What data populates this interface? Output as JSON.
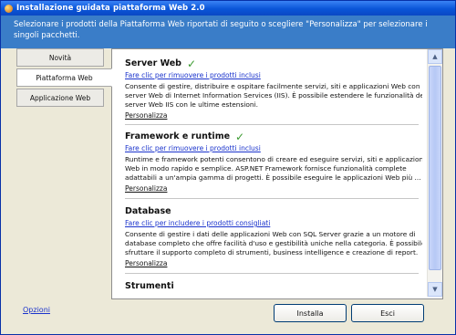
{
  "window": {
    "title": "Installazione guidata piattaforma Web 2.0"
  },
  "banner": {
    "text": "Selezionare i prodotti della Piattaforma Web riportati di seguito o scegliere \"Personalizza\" per selezionare i singoli pacchetti."
  },
  "nav": {
    "tabs": [
      {
        "label": "Novità"
      },
      {
        "label": "Piattaforma Web"
      },
      {
        "label": "Applicazione Web"
      }
    ],
    "active": "Piattaforma Web"
  },
  "sections": [
    {
      "title": "Server Web",
      "checked": true,
      "link": "Fare clic per rimuovere i prodotti inclusi",
      "description": "Consente di gestire, distribuire e ospitare facilmente servizi, siti e applicazioni Web con il server Web di Internet Information Services (IIS). È possibile estendere le funzionalità del server Web IIS con le ultime estensioni.",
      "customize": "Personalizza"
    },
    {
      "title": "Framework e runtime",
      "checked": true,
      "link": "Fare clic per rimuovere i prodotti inclusi",
      "description": "Runtime e framework potenti consentono di creare ed eseguire servizi, siti e applicazioni Web in modo rapido e semplice. ASP.NET Framework fornisce funzionalità complete adattabili a un'ampia gamma di progetti. È possibile eseguire le applicazioni Web più ...",
      "customize": "Personalizza"
    },
    {
      "title": "Database",
      "checked": false,
      "link": "Fare clic per includere i prodotti consigliati",
      "description": "Consente di gestire i dati delle applicazioni Web con SQL Server grazie a un motore di database completo che offre facilità d'uso e gestibilità uniche nella categoria. È possibile sfruttare il supporto completo di strumenti, business intelligence e creazione di report.",
      "customize": "Personalizza"
    },
    {
      "title": "Strumenti"
    }
  ],
  "footer": {
    "options_link": "Opzioni",
    "install_label": "Installa",
    "exit_label": "Esci"
  },
  "icons": {
    "check": "check-icon",
    "scroll_up": "scroll-up-arrow-icon",
    "scroll_down": "scroll-down-arrow-icon"
  },
  "colors": {
    "titlebar": "#0a55d8",
    "banner": "#3a7dc8",
    "link": "#1a33cc",
    "check": "#3a9a2f"
  }
}
